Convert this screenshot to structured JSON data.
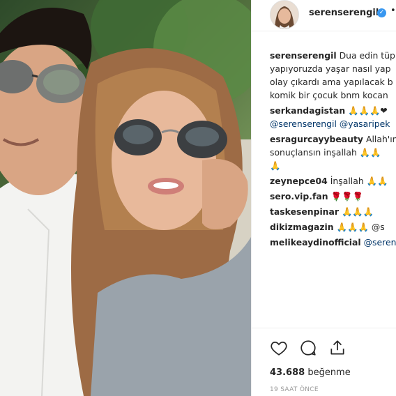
{
  "post": {
    "author": "serenserengil",
    "verified": true,
    "separator": "•"
  },
  "caption": {
    "username": "serenserengil",
    "lines": [
      "Dua edin tüp",
      "yapıyoruzda yaşar nasıl yap",
      "olay çıkardı ama yapılacak b",
      "komik bir çocuk bnm kocan"
    ]
  },
  "comments": [
    {
      "username": "serkandagistan",
      "text": "🙏🙏🙏❤"
    },
    {
      "username": "",
      "mentions": [
        "@serenserengil",
        "@yasaripek"
      ]
    },
    {
      "username": "esragurcayybeauty",
      "text": "Allah'ın"
    },
    {
      "username": "",
      "text": "sonuçlansın inşallah 🙏🙏"
    },
    {
      "username": "",
      "text": "🙏"
    },
    {
      "username": "zeynepce04",
      "text": "İnşallah 🙏🙏"
    },
    {
      "username": "sero.vip.fan",
      "text": "🌹🌹🌹"
    },
    {
      "username": "taskesenpinar",
      "text": "🙏🙏🙏"
    },
    {
      "username": "dikizmagazin",
      "text": "🙏🙏🙏 @s"
    },
    {
      "username": "melikeaydinofficial",
      "text": "@seren"
    }
  ],
  "likes": {
    "count": "43.688",
    "label": "beğenme"
  },
  "timestamp": "19 SAAT ÖNCE",
  "icons": [
    "heart-icon",
    "comment-icon",
    "share-icon",
    "verified-badge-icon"
  ],
  "colors": {
    "link": "#003569",
    "verified": "#3897f0",
    "muted": "#999999",
    "border": "#efefef"
  }
}
